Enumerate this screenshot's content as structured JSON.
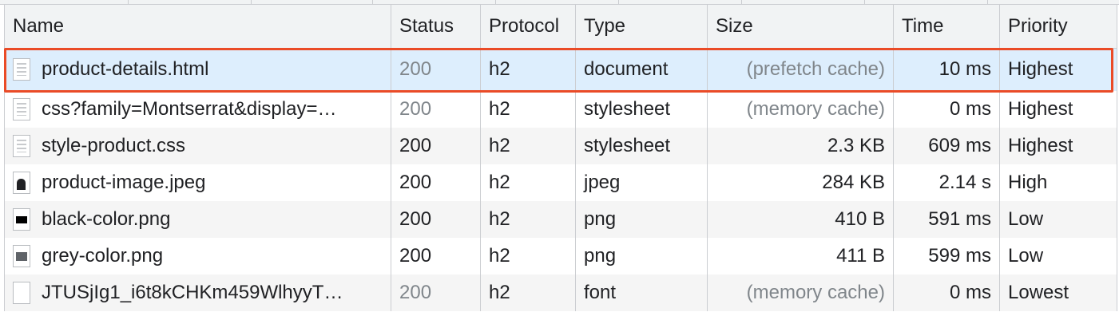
{
  "columns": [
    {
      "key": "name",
      "label": "Name"
    },
    {
      "key": "status",
      "label": "Status"
    },
    {
      "key": "protocol",
      "label": "Protocol"
    },
    {
      "key": "type",
      "label": "Type"
    },
    {
      "key": "size",
      "label": "Size"
    },
    {
      "key": "time",
      "label": "Time"
    },
    {
      "key": "priority",
      "label": "Priority"
    }
  ],
  "rows": [
    {
      "icon": "document-icon",
      "name": "product-details.html",
      "status": "200",
      "status_muted": true,
      "protocol": "h2",
      "type": "document",
      "size": "(prefetch cache)",
      "size_muted": true,
      "time": "10 ms",
      "priority": "Highest",
      "selected": true
    },
    {
      "icon": "document-icon",
      "name": "css?family=Montserrat&display=…",
      "status": "200",
      "status_muted": true,
      "protocol": "h2",
      "type": "stylesheet",
      "size": "(memory cache)",
      "size_muted": true,
      "time": "0 ms",
      "priority": "Highest",
      "selected": false
    },
    {
      "icon": "document-icon",
      "name": "style-product.css",
      "status": "200",
      "status_muted": false,
      "protocol": "h2",
      "type": "stylesheet",
      "size": "2.3 KB",
      "size_muted": false,
      "time": "609 ms",
      "priority": "Highest",
      "selected": false
    },
    {
      "icon": "image-icon",
      "name": "product-image.jpeg",
      "status": "200",
      "status_muted": false,
      "protocol": "h2",
      "type": "jpeg",
      "size": "284 KB",
      "size_muted": false,
      "time": "2.14 s",
      "priority": "High",
      "selected": false
    },
    {
      "icon": "black-swatch-icon",
      "name": "black-color.png",
      "status": "200",
      "status_muted": false,
      "protocol": "h2",
      "type": "png",
      "size": "410 B",
      "size_muted": false,
      "time": "591 ms",
      "priority": "Low",
      "selected": false
    },
    {
      "icon": "grey-swatch-icon",
      "name": "grey-color.png",
      "status": "200",
      "status_muted": false,
      "protocol": "h2",
      "type": "png",
      "size": "411 B",
      "size_muted": false,
      "time": "599 ms",
      "priority": "Low",
      "selected": false
    },
    {
      "icon": "blank-file-icon",
      "name": "JTUSjIg1_i6t8kCHKm459WlhyyT…",
      "status": "200",
      "status_muted": true,
      "protocol": "h2",
      "type": "font",
      "size": "(memory cache)",
      "size_muted": true,
      "time": "0 ms",
      "priority": "Lowest",
      "selected": false
    }
  ],
  "colors": {
    "selected_row_bg": "#ddeefd",
    "highlight_border": "#ea4b27",
    "muted_text": "#80868b",
    "header_bg": "#f1f3f4"
  }
}
